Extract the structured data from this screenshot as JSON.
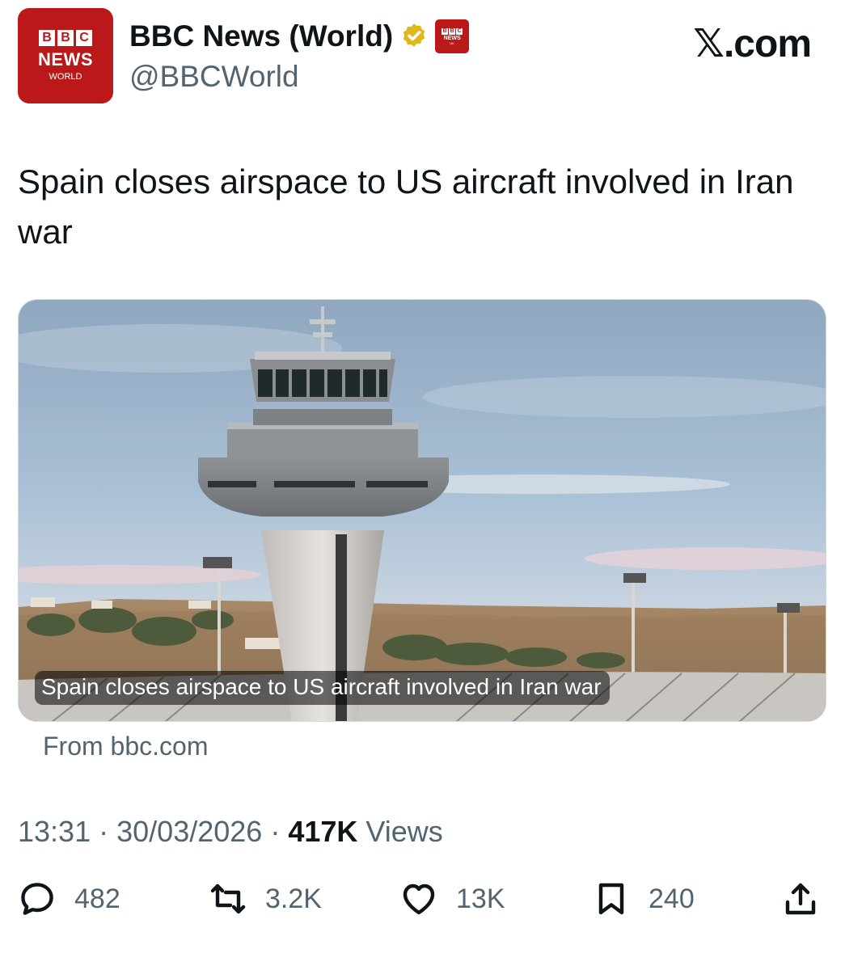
{
  "avatar": {
    "blocks": [
      "B",
      "B",
      "C"
    ],
    "line1": "NEWS",
    "line2": "WORLD"
  },
  "profile": {
    "display_name": "BBC News (World)",
    "handle": "@BBCWorld",
    "verified_icon": "gold-verified-badge",
    "affiliate_badge": {
      "blocks": [
        "B",
        "B",
        "C"
      ],
      "line1": "NEWS",
      "line2": "UK"
    }
  },
  "site_label": "𝕏.com",
  "tweet": {
    "text": "Spain closes airspace to US aircraft involved in Iran war",
    "card": {
      "caption": "Spain closes airspace to US aircraft involved in Iran war",
      "source": "From bbc.com"
    },
    "time": "13:31",
    "date": "30/03/2026",
    "separator": "·",
    "views_count": "417K",
    "views_label": "Views"
  },
  "actions": {
    "replies": "482",
    "reposts": "3.2K",
    "likes": "13K",
    "bookmarks": "240"
  },
  "colors": {
    "bbc_red": "#bb1919",
    "secondary_text": "#536471",
    "primary_text": "#0f1419",
    "verified_gold": "#e2b719"
  }
}
